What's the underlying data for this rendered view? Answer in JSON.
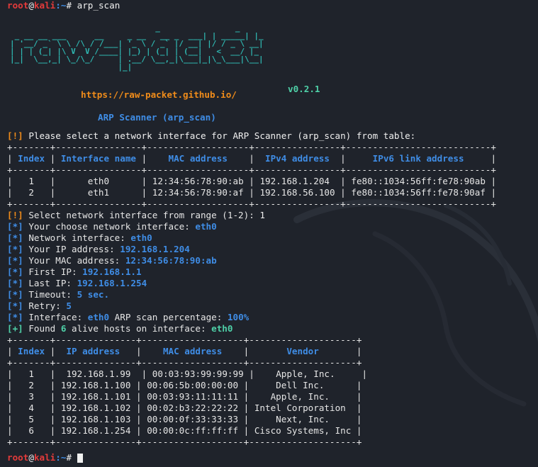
{
  "prompt": {
    "user": "root",
    "at": "@",
    "host": "kali",
    "path": ":~",
    "symbol": "# "
  },
  "command": "arp_scan",
  "banner": {
    "version": "v0.2.1",
    "url": "https://raw-packet.github.io/",
    "title": "ARP Scanner (arp_scan)"
  },
  "select_msg": {
    "tag": "[!]",
    "text": " Please select a network interface for ARP Scanner (arp_scan) from table:"
  },
  "iface_table": {
    "headers": [
      "Index",
      "Interface name",
      "MAC address",
      "IPv4 address",
      "IPv6 link address"
    ],
    "rows": [
      [
        "1",
        "eth0",
        "12:34:56:78:90:ab",
        "192.168.1.204",
        "fe80::1034:56ff:fe78:90ab"
      ],
      [
        "2",
        "eth1",
        "12:34:56:78:90:af",
        "192.168.56.100",
        "fe80::1034:56ff:fe78:90af"
      ]
    ]
  },
  "log": [
    {
      "tag": "[!]",
      "tag_color": "orange",
      "text": " Select network interface from range (1-2): ",
      "value": "1",
      "value_color": "white"
    },
    {
      "tag": "[*]",
      "tag_color": "blue",
      "text": " Your choose network interface: ",
      "value": "eth0",
      "value_color": "blue"
    },
    {
      "tag": "[*]",
      "tag_color": "blue",
      "text": " Network interface: ",
      "value": "eth0",
      "value_color": "blue"
    },
    {
      "tag": "[*]",
      "tag_color": "blue",
      "text": " Your IP address: ",
      "value": "192.168.1.204",
      "value_color": "blue"
    },
    {
      "tag": "[*]",
      "tag_color": "blue",
      "text": " Your MAC address: ",
      "value": "12:34:56:78:90:ab",
      "value_color": "blue"
    },
    {
      "tag": "[*]",
      "tag_color": "blue",
      "text": " First IP: ",
      "value": "192.168.1.1",
      "value_color": "blue"
    },
    {
      "tag": "[*]",
      "tag_color": "blue",
      "text": " Last IP: ",
      "value": "192.168.1.254",
      "value_color": "blue"
    },
    {
      "tag": "[*]",
      "tag_color": "blue",
      "text": " Timeout: ",
      "value": "5 sec.",
      "value_color": "blue"
    },
    {
      "tag": "[*]",
      "tag_color": "blue",
      "text": " Retry: ",
      "value": "5",
      "value_color": "blue"
    }
  ],
  "percent_line": {
    "tag": "[*]",
    "a": " Interface: ",
    "iface": "eth0",
    "b": " ARP scan percentage: ",
    "pct": "100%"
  },
  "found_line": {
    "tag": "[+]",
    "a": " Found ",
    "count": "6",
    "b": " alive hosts on interface: ",
    "iface": "eth0"
  },
  "host_table": {
    "headers": [
      "Index",
      "IP address",
      "MAC address",
      "Vendor"
    ],
    "rows": [
      [
        "1",
        "192.168.1.99",
        "00:03:93:99:99:99",
        "Apple, Inc."
      ],
      [
        "2",
        "192.168.1.100",
        "00:06:5b:00:00:00",
        "Dell Inc."
      ],
      [
        "3",
        "192.168.1.101",
        "00:03:93:11:11:11",
        "Apple, Inc."
      ],
      [
        "4",
        "192.168.1.102",
        "00:02:b3:22:22:22",
        "Intel Corporation"
      ],
      [
        "5",
        "192.168.1.103",
        "00:00:0f:33:33:33",
        "Next, Inc."
      ],
      [
        "6",
        "192.168.1.254",
        "00:00:0c:ff:ff:ff",
        "Cisco Systems, Inc"
      ]
    ]
  },
  "colors": {
    "background": "#1f232b",
    "prompt_red": "#e33b3b",
    "accent_blue": "#3f8de6",
    "warn_orange": "#f08c1a",
    "ok_green": "#4fd1a8",
    "banner_teal": "#2fb8b2"
  }
}
